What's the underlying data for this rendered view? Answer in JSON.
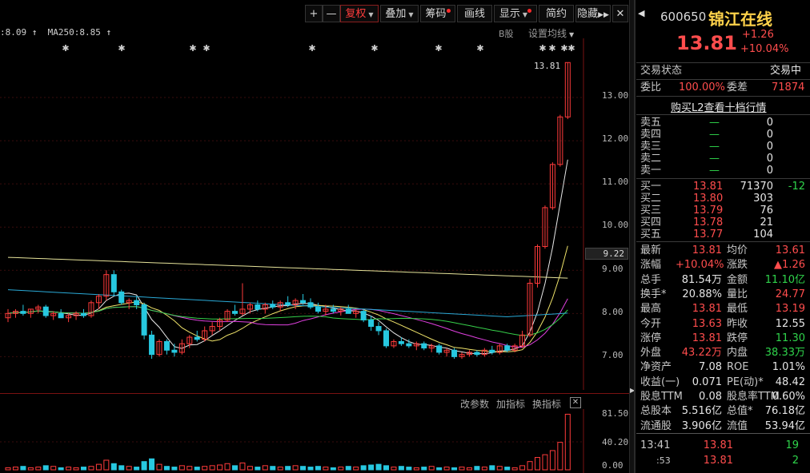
{
  "toolbar": {
    "plus": "+",
    "minus": "—",
    "fuquan": "复权",
    "diejia": "叠加",
    "chouma": "筹码",
    "huaxian": "画线",
    "xianshi": "显示",
    "jianyue": "简约",
    "yincang": "隐藏",
    "close": "✕"
  },
  "chart": {
    "ma_left": "8.09",
    "ma250_label": "MA250:8.85",
    "b_stock": "B股",
    "set_ma": "设置均线",
    "peak_label": "13.81",
    "current_price_box": "9.22",
    "y_ticks": [
      "13.00",
      "12.00",
      "11.00",
      "10.00",
      "9.00",
      "8.00",
      "7.00"
    ],
    "vol_ticks": [
      "81.50",
      "40.20",
      "0.00"
    ],
    "vol_toolbar": [
      "改参数",
      "加指标",
      "换指标"
    ]
  },
  "chart_data": {
    "type": "candlestick",
    "ylim": [
      6.6,
      14.0
    ],
    "candles": [
      [
        7.9,
        8.1,
        7.8,
        8.0
      ],
      [
        8.0,
        8.1,
        7.9,
        8.05
      ],
      [
        8.05,
        8.2,
        7.95,
        8.0
      ],
      [
        8.0,
        8.1,
        7.9,
        8.1
      ],
      [
        8.1,
        8.2,
        8.0,
        8.15
      ],
      [
        8.15,
        8.2,
        7.9,
        7.95
      ],
      [
        7.95,
        8.05,
        7.85,
        8.0
      ],
      [
        8.0,
        8.1,
        7.9,
        7.9
      ],
      [
        7.9,
        8.0,
        7.8,
        7.95
      ],
      [
        7.95,
        8.05,
        7.85,
        8.0
      ],
      [
        8.0,
        8.1,
        7.9,
        7.95
      ],
      [
        7.95,
        8.3,
        7.9,
        8.25
      ],
      [
        8.25,
        8.45,
        8.1,
        8.4
      ],
      [
        8.4,
        9.0,
        8.3,
        8.9
      ],
      [
        8.9,
        9.0,
        8.4,
        8.5
      ],
      [
        8.5,
        8.55,
        8.2,
        8.25
      ],
      [
        8.25,
        8.35,
        8.1,
        8.3
      ],
      [
        8.3,
        8.4,
        8.1,
        8.2
      ],
      [
        8.2,
        8.25,
        7.4,
        7.5
      ],
      [
        7.5,
        7.6,
        6.95,
        7.05
      ],
      [
        7.05,
        7.4,
        7.0,
        7.35
      ],
      [
        7.35,
        7.4,
        7.05,
        7.15
      ],
      [
        7.15,
        7.3,
        7.0,
        7.1
      ],
      [
        7.1,
        7.4,
        7.05,
        7.3
      ],
      [
        7.3,
        7.5,
        7.2,
        7.45
      ],
      [
        7.45,
        7.6,
        7.35,
        7.4
      ],
      [
        7.4,
        7.7,
        7.35,
        7.6
      ],
      [
        7.6,
        7.8,
        7.5,
        7.7
      ],
      [
        7.7,
        7.9,
        7.6,
        7.85
      ],
      [
        7.85,
        8.1,
        7.8,
        8.05
      ],
      [
        8.05,
        8.2,
        7.95,
        8.0
      ],
      [
        8.0,
        8.7,
        7.95,
        8.1
      ],
      [
        8.1,
        8.25,
        8.0,
        8.2
      ],
      [
        8.2,
        8.3,
        8.05,
        8.1
      ],
      [
        8.1,
        8.25,
        8.0,
        8.2
      ],
      [
        8.2,
        8.3,
        8.1,
        8.15
      ],
      [
        8.15,
        8.3,
        8.05,
        8.25
      ],
      [
        8.25,
        8.4,
        8.15,
        8.2
      ],
      [
        8.2,
        8.35,
        8.1,
        8.3
      ],
      [
        8.3,
        8.45,
        8.2,
        8.25
      ],
      [
        8.25,
        8.35,
        8.1,
        8.15
      ],
      [
        8.15,
        8.25,
        8.0,
        8.05
      ],
      [
        8.05,
        8.2,
        7.95,
        8.1
      ],
      [
        8.1,
        8.2,
        8.0,
        8.05
      ],
      [
        8.05,
        8.15,
        7.95,
        8.1
      ],
      [
        8.1,
        8.2,
        8.0,
        8.0
      ],
      [
        8.0,
        8.1,
        7.9,
        8.05
      ],
      [
        8.05,
        8.1,
        7.8,
        7.85
      ],
      [
        7.85,
        7.95,
        7.6,
        7.7
      ],
      [
        7.7,
        7.8,
        7.5,
        7.6
      ],
      [
        7.6,
        7.65,
        7.2,
        7.25
      ],
      [
        7.25,
        7.4,
        7.2,
        7.35
      ],
      [
        7.35,
        7.45,
        7.25,
        7.3
      ],
      [
        7.3,
        7.4,
        7.2,
        7.25
      ],
      [
        7.25,
        7.35,
        7.15,
        7.3
      ],
      [
        7.3,
        7.35,
        7.15,
        7.2
      ],
      [
        7.2,
        7.3,
        7.1,
        7.25
      ],
      [
        7.25,
        7.3,
        7.05,
        7.1
      ],
      [
        7.1,
        7.2,
        7.0,
        7.15
      ],
      [
        7.15,
        7.2,
        6.95,
        7.0
      ],
      [
        7.0,
        7.1,
        6.95,
        7.05
      ],
      [
        7.05,
        7.15,
        7.0,
        7.1
      ],
      [
        7.1,
        7.15,
        7.0,
        7.05
      ],
      [
        7.05,
        7.2,
        7.0,
        7.15
      ],
      [
        7.15,
        7.25,
        7.05,
        7.1
      ],
      [
        7.1,
        7.3,
        7.05,
        7.25
      ],
      [
        7.25,
        7.3,
        7.1,
        7.15
      ],
      [
        7.15,
        7.3,
        7.1,
        7.25
      ],
      [
        7.25,
        7.6,
        7.2,
        7.5
      ],
      [
        7.5,
        8.8,
        7.45,
        8.7
      ],
      [
        8.7,
        9.6,
        8.6,
        9.55
      ],
      [
        9.55,
        10.5,
        9.5,
        10.45
      ],
      [
        10.45,
        11.5,
        10.4,
        11.45
      ],
      [
        11.45,
        12.6,
        11.4,
        12.55
      ],
      [
        12.55,
        13.81,
        12.5,
        13.81
      ]
    ],
    "vol": [
      3,
      4,
      5,
      3,
      4,
      6,
      5,
      3,
      4,
      3,
      4,
      5,
      8,
      14,
      9,
      6,
      5,
      4,
      12,
      16,
      8,
      5,
      4,
      6,
      5,
      4,
      5,
      6,
      7,
      9,
      6,
      10,
      5,
      4,
      6,
      5,
      4,
      5,
      6,
      5,
      4,
      5,
      4,
      3,
      4,
      5,
      4,
      6,
      7,
      8,
      6,
      4,
      5,
      4,
      3,
      4,
      5,
      3,
      4,
      3,
      4,
      3,
      5,
      4,
      6,
      5,
      4,
      3,
      6,
      12,
      18,
      22,
      28,
      40,
      81
    ]
  },
  "panel": {
    "code": "600650",
    "name": "锦江在线",
    "price": "13.81",
    "change": "+1.26",
    "change_pct": "+10.04%",
    "status_label": "交易状态",
    "status_value": "交易中",
    "weibi_label": "委比",
    "weibi_value": "100.00%",
    "weicha_label": "委差",
    "weicha_value": "71874",
    "l2_link": "购买L2查看十档行情",
    "sell": [
      {
        "label": "卖五",
        "price": "—",
        "vol": "0"
      },
      {
        "label": "卖四",
        "price": "—",
        "vol": "0"
      },
      {
        "label": "卖三",
        "price": "—",
        "vol": "0"
      },
      {
        "label": "卖二",
        "price": "—",
        "vol": "0"
      },
      {
        "label": "卖一",
        "price": "—",
        "vol": "0"
      }
    ],
    "buy": [
      {
        "label": "买一",
        "price": "13.81",
        "vol": "71370",
        "diff": "-12"
      },
      {
        "label": "买二",
        "price": "13.80",
        "vol": "303",
        "diff": ""
      },
      {
        "label": "买三",
        "price": "13.79",
        "vol": "76",
        "diff": ""
      },
      {
        "label": "买四",
        "price": "13.78",
        "vol": "21",
        "diff": ""
      },
      {
        "label": "买五",
        "price": "13.77",
        "vol": "104",
        "diff": ""
      }
    ],
    "stats": [
      [
        "最新",
        "13.81",
        "均价",
        "13.61"
      ],
      [
        "涨幅",
        "+10.04%",
        "涨跌",
        "▲1.26"
      ],
      [
        "总手",
        "81.54万",
        "金额",
        "11.10亿"
      ],
      [
        "换手*",
        "20.88%",
        "量比",
        "24.77"
      ],
      [
        "最高",
        "13.81",
        "最低",
        "13.19"
      ],
      [
        "今开",
        "13.63",
        "昨收",
        "12.55"
      ],
      [
        "涨停",
        "13.81",
        "跌停",
        "11.30"
      ],
      [
        "外盘",
        "43.22万",
        "内盘",
        "38.33万"
      ],
      [
        "净资产",
        "7.08",
        "ROE",
        "1.01%"
      ],
      [
        "收益(一)",
        "0.071",
        "PE(动)*",
        "48.42"
      ],
      [
        "股息TTM",
        "0.08",
        "股息率TTM",
        "0.60%"
      ],
      [
        "总股本",
        "5.516亿",
        "总值*",
        "76.18亿"
      ],
      [
        "流通股",
        "3.906亿",
        "流值",
        "53.94亿"
      ]
    ],
    "ticks": [
      {
        "time": "13:41",
        "price": "13.81",
        "vol": "19"
      },
      {
        "time": ":53",
        "price": "13.81",
        "vol": "2"
      }
    ]
  }
}
